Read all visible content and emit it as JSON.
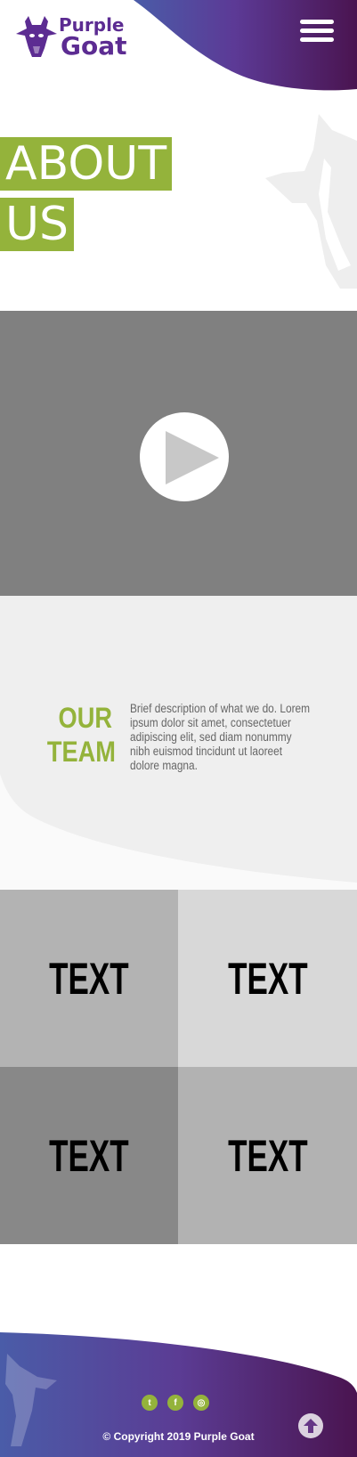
{
  "header": {
    "logo_line1": "Purple",
    "logo_line2": "Goat",
    "menu_icon": "hamburger-menu-icon"
  },
  "about": {
    "line1": "ABOUT",
    "line2": "US"
  },
  "video": {
    "play_icon": "play-icon"
  },
  "team": {
    "title_line1": "OUR",
    "title_line2": "TEAM",
    "description": "Brief description of what we do. Lorem ipsum dolor sit amet, consectetuer adipiscing elit, sed diam nonummy nibh euismod tincidunt ut laoreet dolore magna."
  },
  "grid": {
    "cells": [
      "TEXT",
      "TEXT",
      "TEXT",
      "TEXT"
    ]
  },
  "footer": {
    "social": [
      {
        "icon": "twitter-icon",
        "glyph": "t"
      },
      {
        "icon": "facebook-icon",
        "glyph": "f"
      },
      {
        "icon": "instagram-icon",
        "glyph": "◎"
      }
    ],
    "copyright": "© Copyright 2019 Purple Goat",
    "back_to_top_icon": "arrow-up-icon"
  },
  "colors": {
    "brand_purple": "#5c2c92",
    "accent_green": "#94b33b",
    "gradient_start": "#4a5ca8",
    "gradient_end": "#4a1450"
  }
}
